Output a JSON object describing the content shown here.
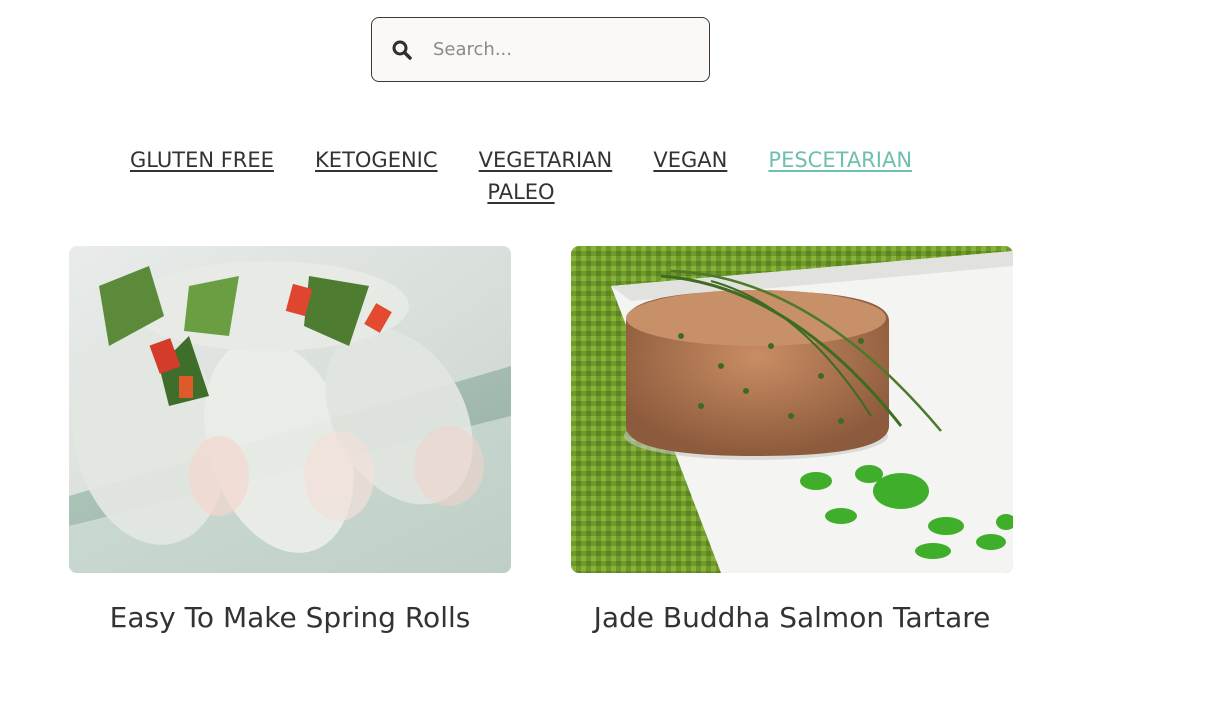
{
  "search": {
    "placeholder": "Search...",
    "icon": "search-icon"
  },
  "filters": [
    {
      "label": "GLUTEN FREE",
      "active": false
    },
    {
      "label": "KETOGENIC",
      "active": false
    },
    {
      "label": "VEGETARIAN",
      "active": false
    },
    {
      "label": "VEGAN",
      "active": false
    },
    {
      "label": "PESCETARIAN",
      "active": true
    },
    {
      "label": "PALEO",
      "active": false
    }
  ],
  "colors": {
    "active_filter": "#6fbfae",
    "text": "#333333",
    "search_bg": "#fbf8f5"
  },
  "recipes": [
    {
      "title": "Easy To Make Spring Rolls",
      "image": "spring-rolls-photo"
    },
    {
      "title": "Jade Buddha Salmon Tartare",
      "image": "salmon-tartare-photo"
    }
  ]
}
